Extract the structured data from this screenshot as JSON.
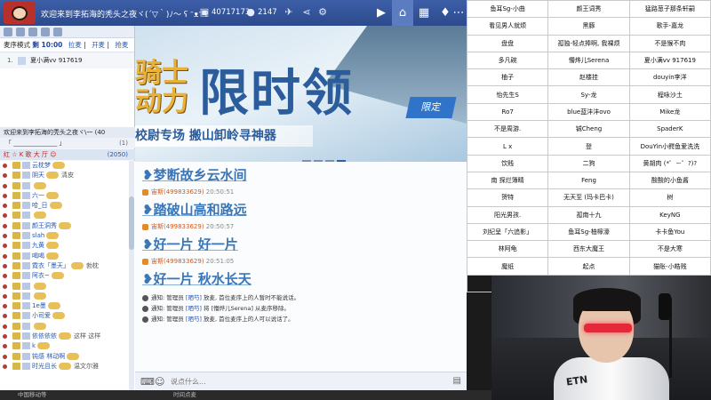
{
  "header": {
    "title": "欢迎来到李拓海的秃头之夜ヾ(´▽｀)ﾉ～ ʕ ᵔᴥᵔ ʔ",
    "room_id": "40717173",
    "online_count": "2147",
    "icons": [
      "id-icon",
      "user-icon",
      "plane-icon",
      "share-icon",
      "gear-icon"
    ],
    "tabs": [
      {
        "name": "live-tab",
        "icon": "▶"
      },
      {
        "name": "home-tab",
        "icon": "⌂"
      },
      {
        "name": "list-tab",
        "icon": "▦"
      },
      {
        "name": "game-tab",
        "icon": "♦"
      },
      {
        "name": "more-tab",
        "icon": "⋯"
      }
    ]
  },
  "queue": {
    "mode_label": "麦序模式",
    "time": "剩 10:00",
    "actions": [
      "拉麦",
      "开麦",
      "抢麦"
    ],
    "items": [
      {
        "num": "1.",
        "name": "夏小满vv",
        "id": "917619"
      }
    ]
  },
  "room_bar": {
    "title": "欢迎来到李拓海的秃头之夜ヾ\\一",
    "count": "(40",
    "sub": "「 ______________ 」",
    "sub_count": "(1)",
    "filter": "红 ☆ K 歌 大 厅 ☺",
    "filter_count": "(2050)"
  },
  "users": [
    {
      "name": "云枕梦",
      "extra": ""
    },
    {
      "name": "阴天",
      "extra": "清皮"
    },
    {
      "name": "",
      "extra": ""
    },
    {
      "name": "六一",
      "extra": ""
    },
    {
      "name": "哈_日",
      "extra": ""
    },
    {
      "name": "",
      "extra": ""
    },
    {
      "name": "颜王洞秀",
      "extra": ""
    },
    {
      "name": "slah",
      "extra": ""
    },
    {
      "name": "九黄",
      "extra": ""
    },
    {
      "name": "喝喝",
      "extra": ""
    },
    {
      "name": "霓衣「墨天」",
      "extra": "勃枕"
    },
    {
      "name": "阿衣~",
      "extra": ""
    },
    {
      "name": "",
      "extra": ""
    },
    {
      "name": "",
      "extra": ""
    },
    {
      "name": "1e墨",
      "extra": ""
    },
    {
      "name": "小司爱",
      "extra": ""
    },
    {
      "name": "",
      "extra": ""
    },
    {
      "name": "依依依依",
      "extra": "这样 这样"
    },
    {
      "name": "k",
      "extra": ""
    },
    {
      "name": "钝感 林动啊",
      "extra": ""
    },
    {
      "name": "时光且长",
      "extra": "温文尔雅"
    }
  ],
  "banner": {
    "knight_text": "骑士\n动力",
    "big_text": "限时领",
    "sub_text": "校尉专场 搬山卸岭寻神器",
    "tag_text": "限定"
  },
  "messages": [
    {
      "lyric": "❥梦断故乡云水间",
      "user": "宙斯(499833629)",
      "time": "20:50:51"
    },
    {
      "lyric": "❥踏破山高和路远",
      "user": "宙斯(499833629)",
      "time": "20:50:57"
    },
    {
      "lyric": "❥好一片 好一片",
      "user": "宙斯(499833629)",
      "time": "20:51:05"
    },
    {
      "lyric": "❥好一片 秋水长天",
      "user": "",
      "time": ""
    }
  ],
  "notices": [
    {
      "prefix": "通知:",
      "pre": "管理员",
      "name": "[晒芍]",
      "post": "放麦, 首位麦序上的人暂时不能说话。"
    },
    {
      "prefix": "通知:",
      "pre": "管理员",
      "name": "[晒芍]",
      "post": "将 [懵烨儿Serena] 从麦序移除。"
    },
    {
      "prefix": "通知:",
      "pre": "管理员",
      "name": "[晒芍]",
      "post": "放麦, 首位麦序上的人可以说话了。"
    }
  ],
  "chat_input": {
    "placeholder": "说点什么..."
  },
  "bottom_bar": {
    "left": "中国移动等",
    "mid": "时间点麦"
  },
  "name_table": [
    [
      "鱼耳Sg-小曲",
      "颜王词秀",
      "猛路葱子那条轩嗣"
    ],
    [
      "看见男人就烦",
      "黑豚",
      "歌手-嘉龙"
    ],
    [
      "盘盘",
      "孤独-轻点捧啊, 我裸烦",
      "不是猴不肉"
    ],
    [
      "多凡碗",
      "懵烨儿Serena",
      "夏小满vv 917619"
    ],
    [
      "柚子",
      "赵楼挂",
      "douyin李洋"
    ],
    [
      "怡先生S",
      "Sy-龙",
      "程咏沙土"
    ],
    [
      "Ro7",
      "blue蓝沣沣ovo",
      "Mike龙"
    ],
    [
      "不是周游.",
      "铖Cheng",
      "SpaderK"
    ],
    [
      "L x",
      "登",
      "DouYin小鳄鱼爱洗洗"
    ],
    [
      "饮贱",
      "二狗",
      "黄胡肉 (*゜－゜?)?"
    ],
    [
      "南 探烂簿睛",
      "Feng",
      "酸酸的小鱼酱"
    ],
    [
      "贺特",
      "无天至 (玛卡巴卡)",
      "树"
    ],
    [
      "阳光男孩.",
      "孤南十九",
      "KeyNG"
    ],
    [
      "刘纪呈「六追影」",
      "鱼耳Sg-柚檸濠",
      "卡卡鱼You"
    ],
    [
      "林阿龟",
      "西东大魔王",
      "不是大寒"
    ],
    [
      "魔纸",
      "起点",
      "猫账-小皓贱"
    ],
    [
      "鱼耳Sg-破音",
      "唱歌的WuKong52782",
      "王老九"
    ]
  ],
  "webcam": {
    "shirt_text": "ETN"
  },
  "colors": {
    "accent": "#2c4a8c",
    "lyric": "#3a77b8",
    "user": "#d05a1e"
  }
}
